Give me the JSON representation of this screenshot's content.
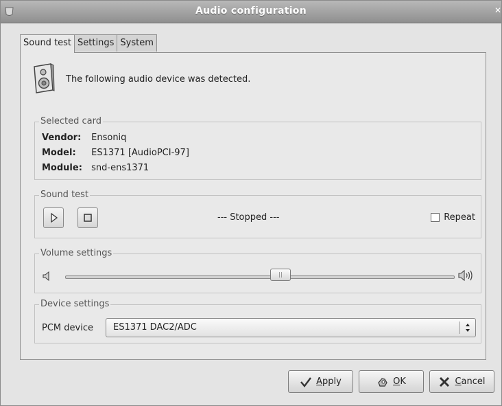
{
  "window": {
    "title": "Audio configuration"
  },
  "tabs": [
    {
      "label": "Sound test",
      "active": true
    },
    {
      "label": "Settings",
      "active": false
    },
    {
      "label": "System",
      "active": false
    }
  ],
  "detect": {
    "message": "The following audio device was detected.",
    "icon": "speaker-icon"
  },
  "selected_card": {
    "title": "Selected card",
    "rows": [
      {
        "label": "Vendor:",
        "value": "Ensoniq"
      },
      {
        "label": "Model:",
        "value": "ES1371 [AudioPCI-97]"
      },
      {
        "label": "Module:",
        "value": "snd-ens1371"
      }
    ]
  },
  "sound_test": {
    "title": "Sound test",
    "play_icon": "play-icon",
    "stop_icon": "stop-icon",
    "status": "--- Stopped ---",
    "repeat_label": "Repeat",
    "repeat_checked": false
  },
  "volume": {
    "title": "Volume settings",
    "level": 0.55
  },
  "device": {
    "title": "Device settings",
    "pcm_label": "PCM device",
    "pcm_value": "ES1371 DAC2/ADC"
  },
  "buttons": {
    "apply": {
      "underline": "A",
      "rest": "pply"
    },
    "ok": {
      "underline": "O",
      "rest": "K"
    },
    "cancel": {
      "underline": "C",
      "rest": "ancel"
    }
  }
}
